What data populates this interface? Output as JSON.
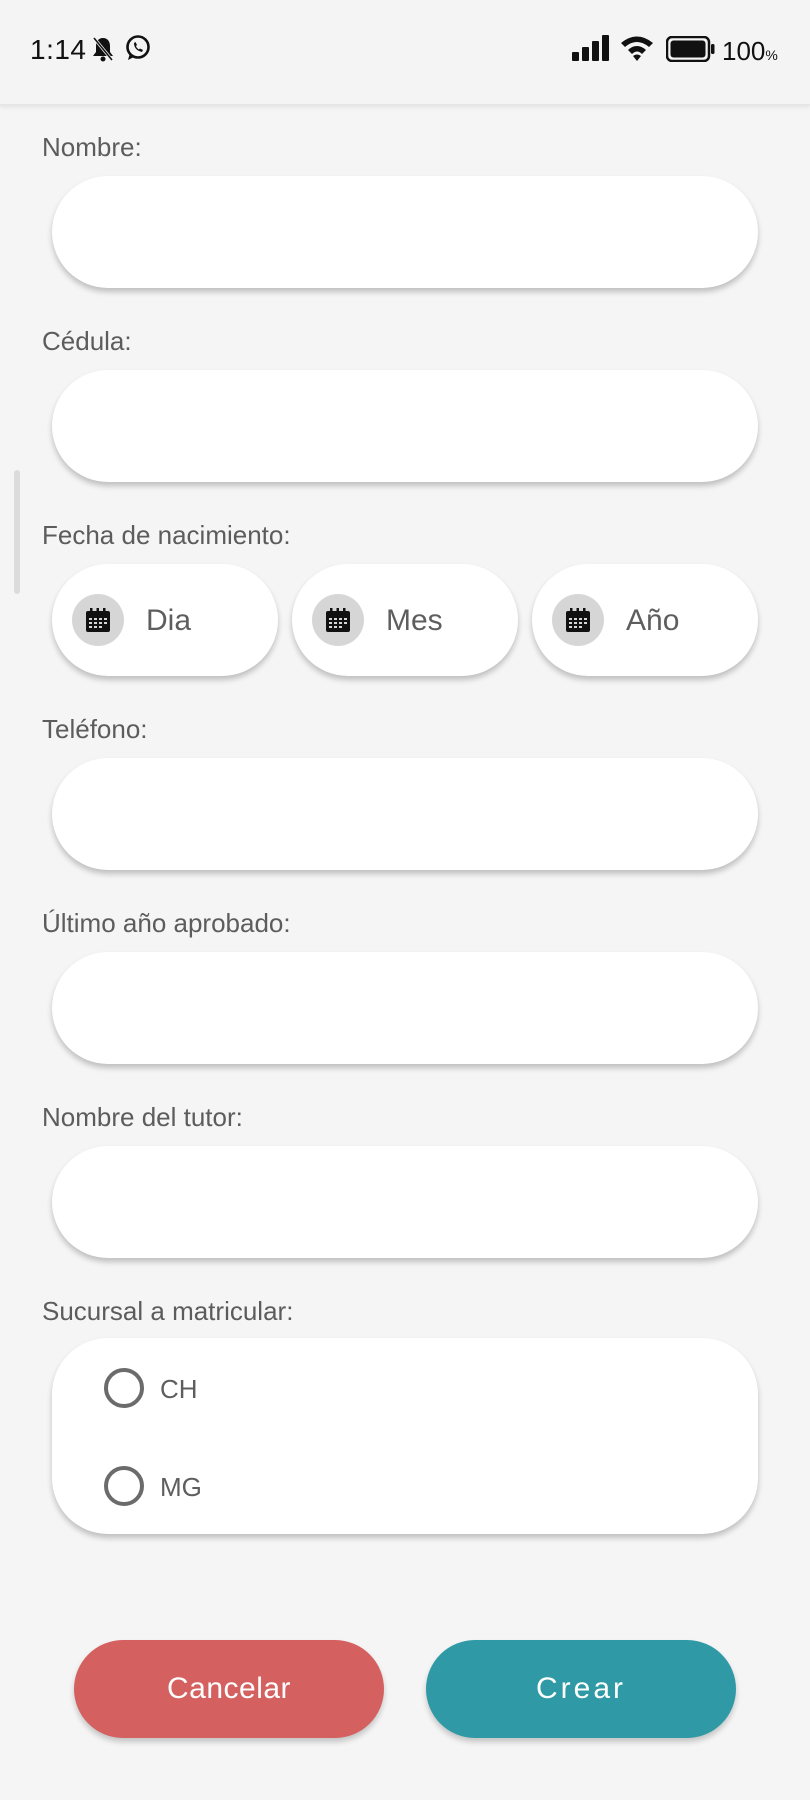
{
  "status_bar": {
    "time": "1:14",
    "battery_percent": "100",
    "battery_suffix": "%",
    "icons": [
      "bell-muted-icon",
      "whatsapp-icon",
      "signal-icon",
      "wifi-icon",
      "battery-icon"
    ]
  },
  "form": {
    "nombre_label": "Nombre:",
    "nombre_value": "",
    "cedula_label": "Cédula:",
    "cedula_value": "",
    "fecha_label": "Fecha de nacimiento:",
    "fecha_dia": "Dia",
    "fecha_mes": "Mes",
    "fecha_anio": "Año",
    "telefono_label": "Teléfono:",
    "telefono_value": "",
    "ultimo_anio_label": "Último año aprobado:",
    "ultimo_anio_value": "",
    "tutor_label": "Nombre del tutor:",
    "tutor_value": "",
    "sucursal_label": "Sucursal a matricular:",
    "sucursal_options": [
      "CH",
      "MG"
    ]
  },
  "actions": {
    "cancel_label": "Cancelar",
    "create_label": "Crear"
  },
  "colors": {
    "cancel": "#d46060",
    "create": "#2f9aa5",
    "background": "#f5f5f5"
  }
}
